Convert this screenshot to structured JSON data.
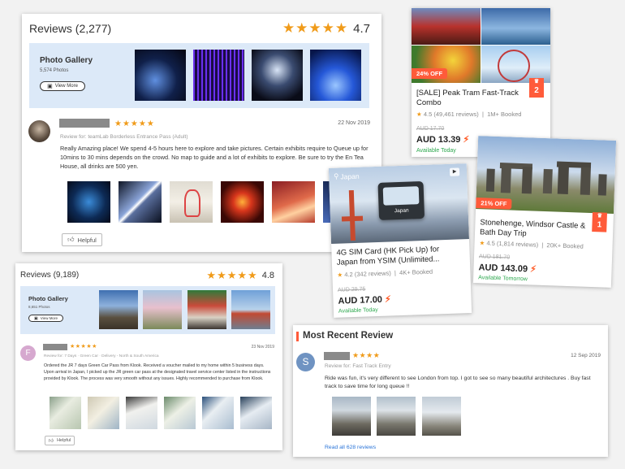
{
  "review1": {
    "title": "Reviews (2,277)",
    "stars": "★★★★★",
    "score": "4.7",
    "gallery_title": "Photo Gallery",
    "gallery_count": "5,574 Photos",
    "view_more": "View More",
    "date": "22 Nov 2019",
    "review_for": "Review for: teamLab Borderless Entrance Pass (Adult)",
    "body": "Really Amazing place! We spend 4-5 hours here to explore and take pictures. Certain exhibits require to Queue up for 10mins to 30 mins depends on the crowd. No map to guide and a lot of exhibits to explore. Be sure to try the En Tea House, all drinks are 500 yen.",
    "helpful": "Helpful"
  },
  "review2": {
    "title": "Reviews (9,189)",
    "stars": "★★★★★",
    "score": "4.8",
    "gallery_title": "Photo Gallery",
    "gallery_count": "8,651 Photos",
    "view_more": "View More",
    "avatar_letter": "F",
    "date": "23 Nov 2019",
    "review_for": "Review for: 7 Days · Green Car · Delivery - North & South America",
    "body": "Ordered the JR 7 days Green Car Pass from Klook. Received a voucher mailed to my home within 5 business days. Upon arrival in Japan, I picked up the JR green car pass at the designated travel service center listed in the instructions provided by Klook. The process was very smooth without any issues. Highly recommended to purchase from Klook.",
    "helpful": "Helpful"
  },
  "recent": {
    "title": "Most Recent Review",
    "avatar_letter": "S",
    "stars": "★★★★",
    "date": "12 Sep 2019",
    "review_for": "Review for: Fast Track Entry",
    "body": "Ride was fun, it's very different to see London from top. I got to see so many beautiful architectures . Buy fast track to save time for long queue !!",
    "read_all": "Read all 628 reviews"
  },
  "product1": {
    "discount": "24% OFF",
    "rank": "2",
    "title": "[SALE] Peak Tram Fast-Track Combo",
    "rating": "4.5",
    "reviews": "(49,461 reviews)",
    "booked": "1M+ Booked",
    "old_price": "AUD 17.70",
    "price": "AUD 13.39",
    "availability": "Available Today"
  },
  "product2": {
    "discount": "21% OFF",
    "rank": "1",
    "title": "Stonehenge, Windsor Castle & Bath Day Trip",
    "rating": "4.5",
    "reviews": "(1,814 reviews)",
    "booked": "20K+ Booked",
    "old_price": "AUD 181.70",
    "price": "AUD 143.09",
    "availability": "Available Tomorrow"
  },
  "product3": {
    "location": "Japan",
    "card_label": "Japan",
    "title": "4G SIM Card (HK Pick Up) for Japan from YSIM (Unlimited...",
    "rating": "4.2",
    "reviews": "(342 reviews)",
    "booked": "4K+ Booked",
    "old_price": "AUD 29.75",
    "price": "AUD 17.00",
    "availability": "Available Today"
  },
  "colors": {
    "accent": "#ff5b3a",
    "star": "#f09b1a",
    "available": "#2ea84f",
    "link": "#2a74d8",
    "gallery_bg": "#dce9f8"
  },
  "icons": [
    "thumbs-up-icon",
    "image-icon",
    "lightning-icon",
    "crown-icon",
    "location-pin-icon",
    "play-icon"
  ]
}
